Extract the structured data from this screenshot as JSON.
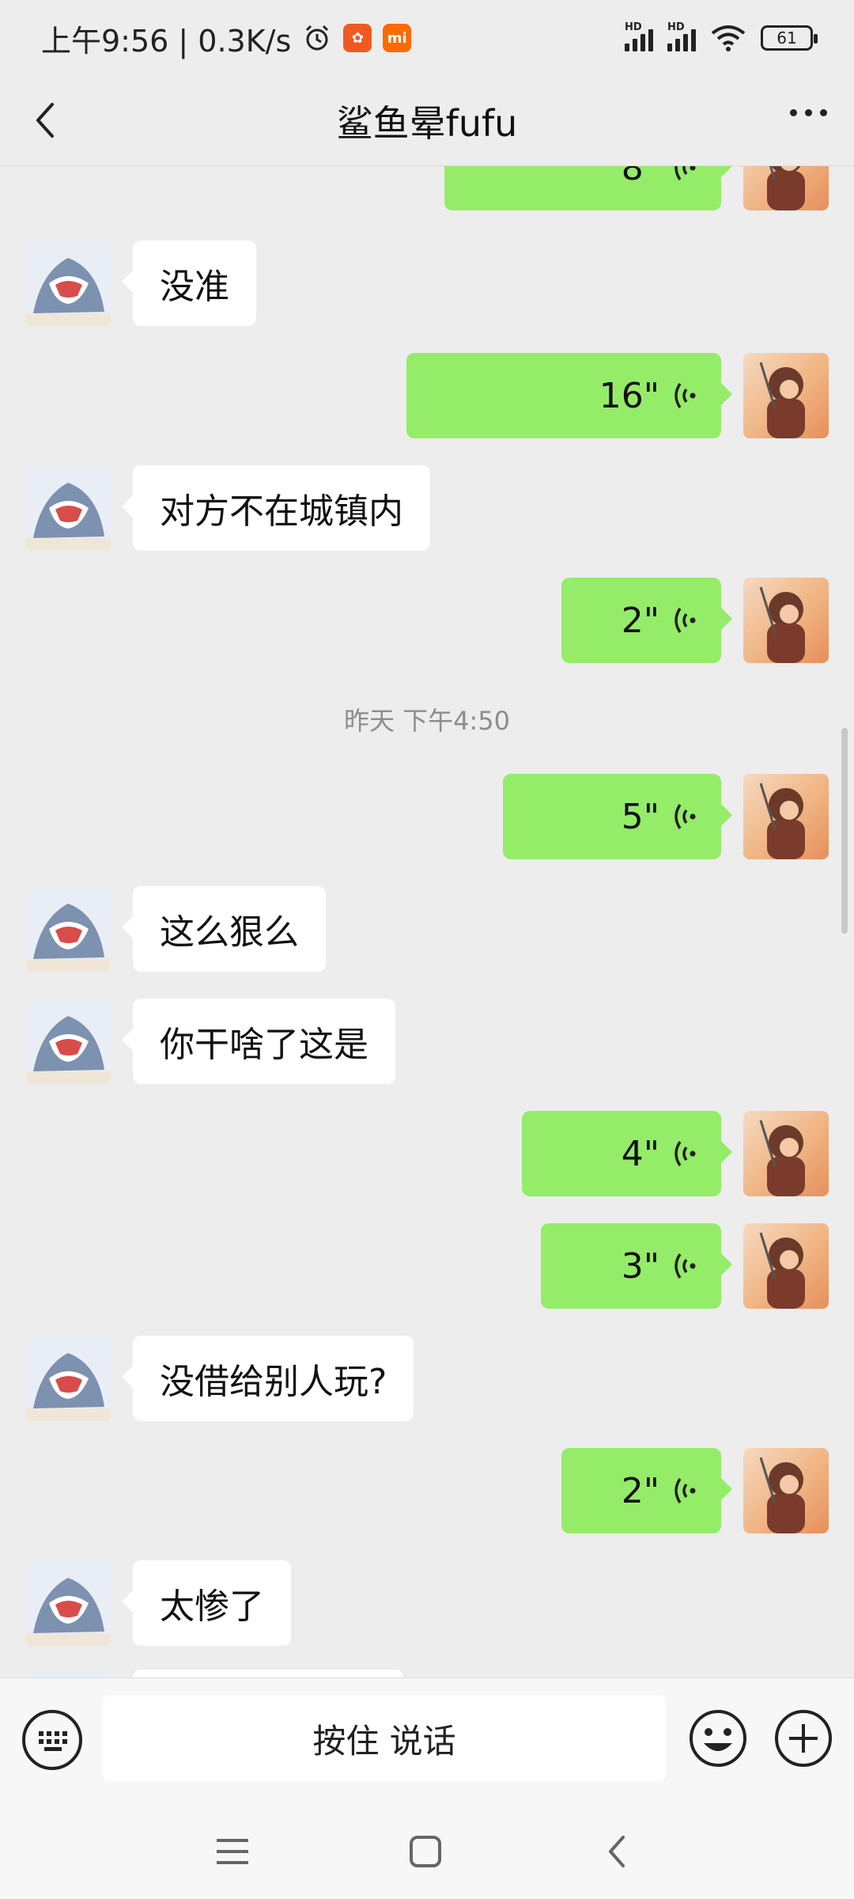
{
  "status_bar": {
    "time_speed": "上午9:56 | 0.3K/s",
    "signal_hd_1": "HD",
    "signal_hd_2": "HD",
    "battery": "61"
  },
  "title_bar": {
    "title": "鲨鱼晕fufu"
  },
  "messages": [
    {
      "side": "out",
      "type": "voice",
      "duration": "8\""
    },
    {
      "side": "in",
      "type": "text",
      "text": "没准"
    },
    {
      "side": "out",
      "type": "voice",
      "duration": "16\""
    },
    {
      "side": "in",
      "type": "text",
      "text": "对方不在城镇内"
    },
    {
      "side": "out",
      "type": "voice",
      "duration": "2\""
    },
    {
      "type": "timestamp",
      "text": "昨天 下午4:50"
    },
    {
      "side": "out",
      "type": "voice",
      "duration": "5\""
    },
    {
      "side": "in",
      "type": "text",
      "text": "这么狠么"
    },
    {
      "side": "in",
      "type": "text",
      "text": "你干啥了这是"
    },
    {
      "side": "out",
      "type": "voice",
      "duration": "4\""
    },
    {
      "side": "out",
      "type": "voice",
      "duration": "3\""
    },
    {
      "side": "in",
      "type": "text",
      "text": "没借给别人玩?"
    },
    {
      "side": "out",
      "type": "voice",
      "duration": "2\""
    },
    {
      "side": "in",
      "type": "text",
      "text": "太惨了"
    }
  ],
  "input_bar": {
    "hold_to_talk": "按住 说话"
  },
  "icons": {
    "back": "back-arrow-icon",
    "more": "more-dots-icon",
    "voice": "voice-wave-icon",
    "keyboard": "keyboard-icon",
    "emoji": "emoji-icon",
    "plus": "plus-icon"
  },
  "colors": {
    "outgoing_bubble": "#95ec69",
    "incoming_bubble": "#ffffff",
    "background": "#ededed"
  }
}
